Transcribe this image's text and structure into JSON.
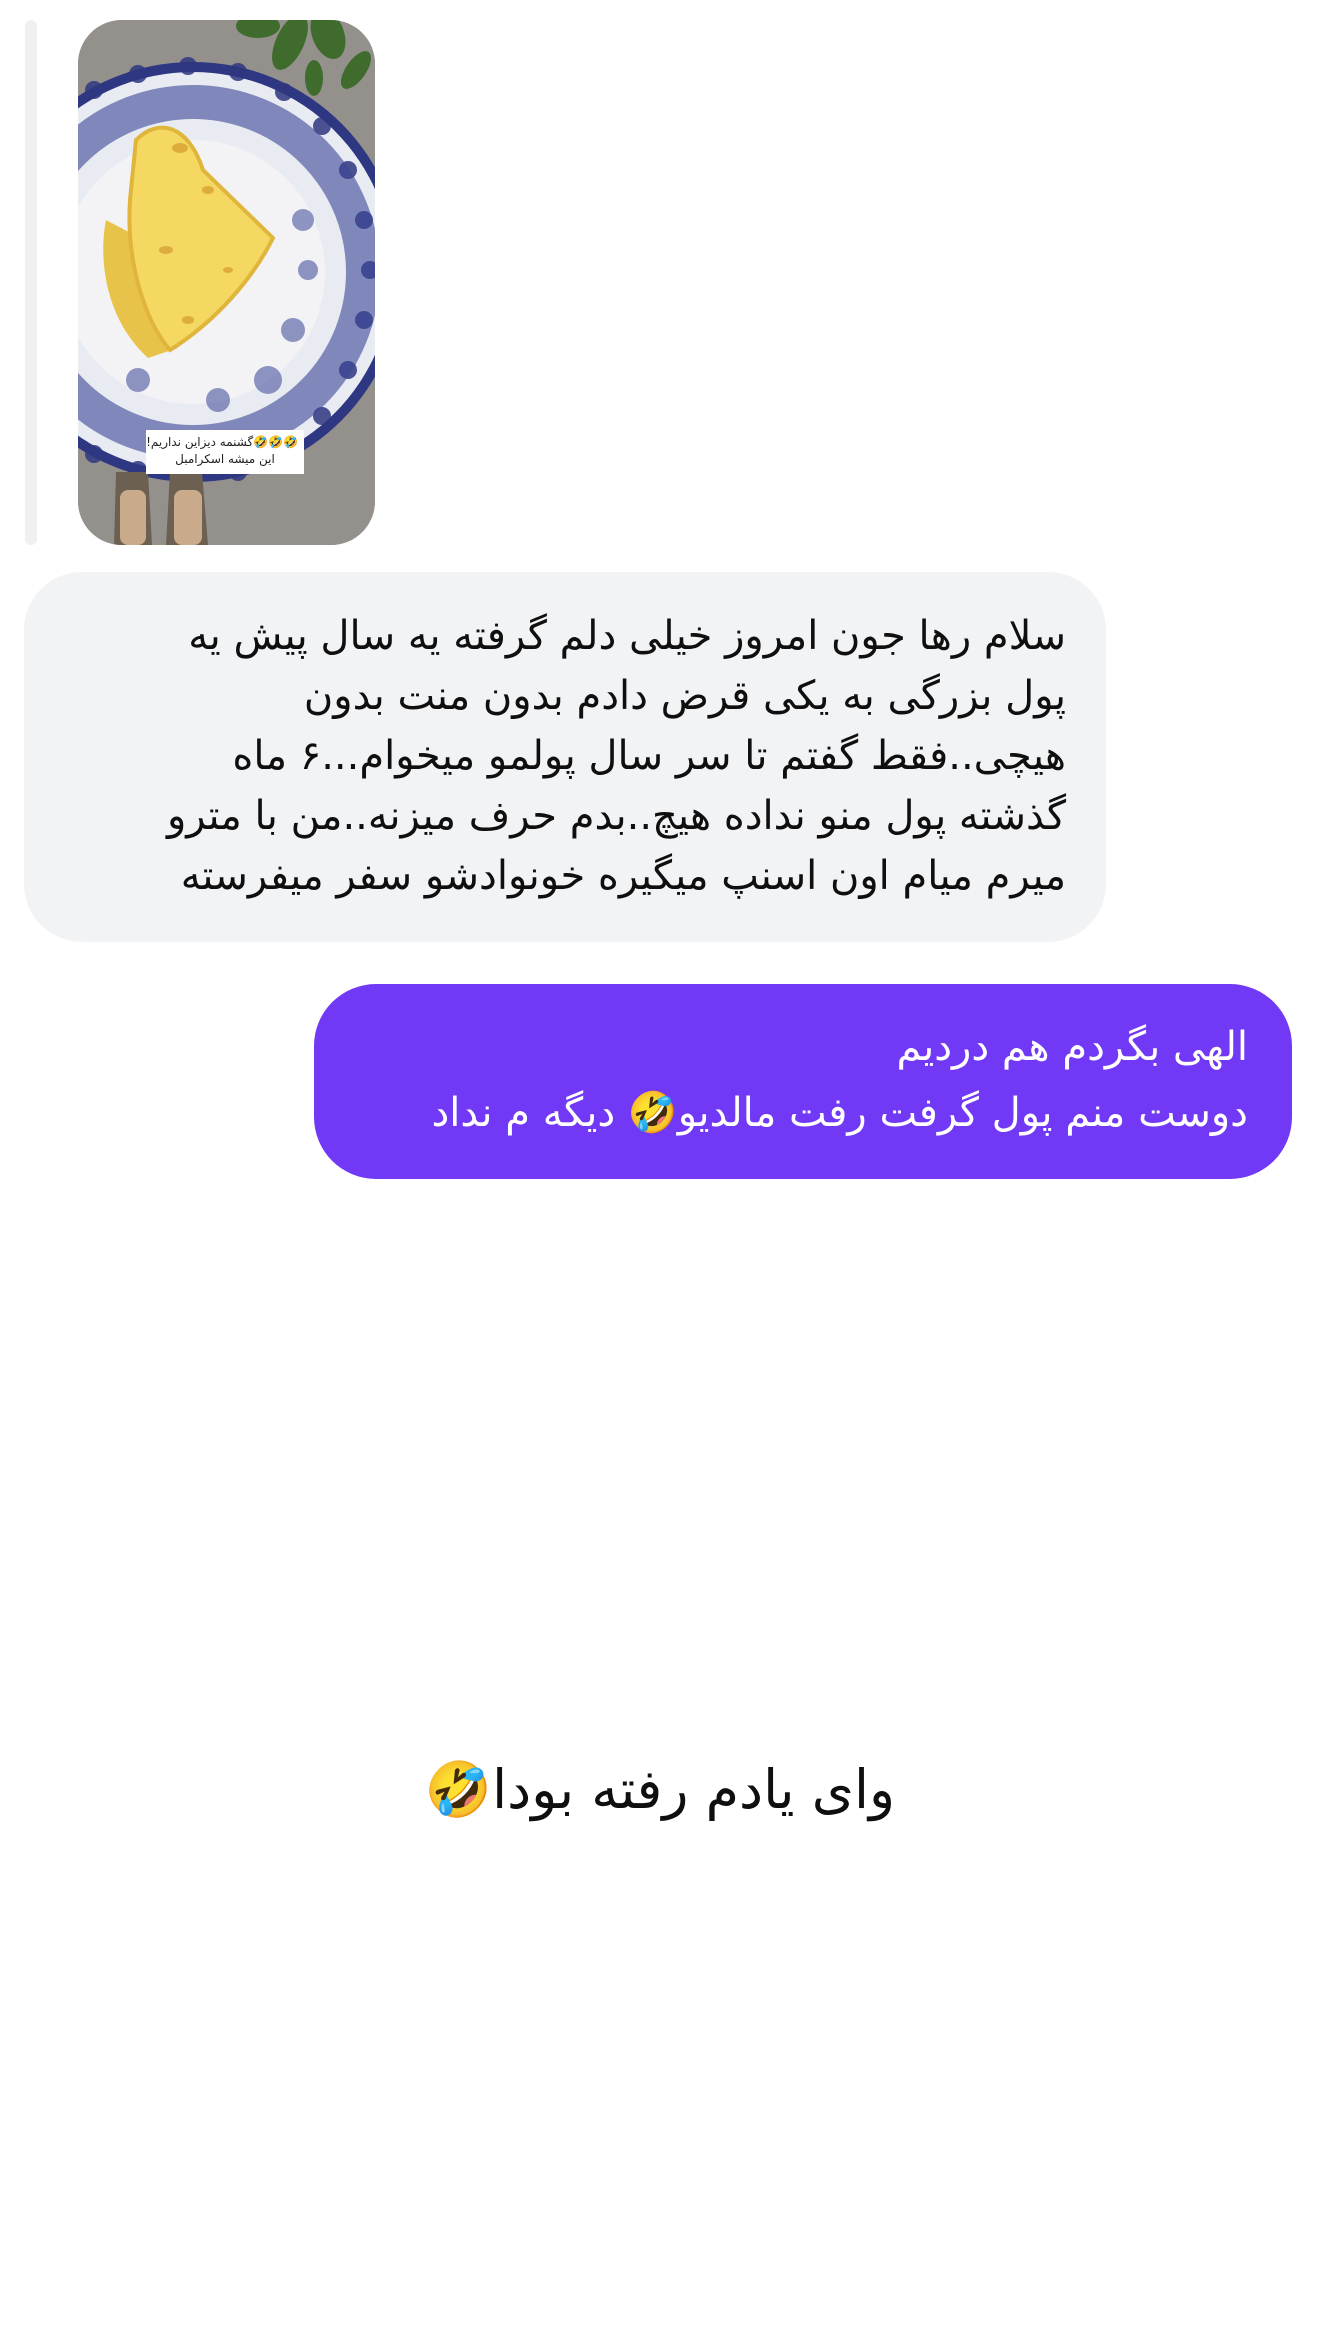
{
  "story_reply": {
    "caption_line_1": "🤣🤣🤣گشنمه دیزاین نداریم!",
    "caption_line_2": "این میشه اسکرامبل"
  },
  "messages": [
    {
      "direction": "received",
      "lines": [
        "سلام رها جون امروز خیلی دلم گرفته یه سال پیش یه",
        "پول بزرگی به یکی قرض دادم بدون منت بدون",
        "هیچی..فقط گفتم تا سر سال پولمو میخوام...۶ ماه",
        "گذشته پول منو نداده هیچ..بدم حرف میزنه..من با مترو",
        "میرم میام اون اسنپ میگیره خونوادشو سفر میفرسته"
      ]
    },
    {
      "direction": "sent",
      "lines": [
        "الهی بگردم هم دردیم",
        "دوست منم پول گرفت رفت مالدیو🤣 دیگه م نداد"
      ]
    },
    {
      "direction": "received",
      "text": "وای یادم رفته بودا🤣"
    }
  ],
  "colors": {
    "sent_bubble": "#7139f6",
    "received_bubble": "#f2f3f5",
    "reply_bar": "#eff0f2"
  }
}
